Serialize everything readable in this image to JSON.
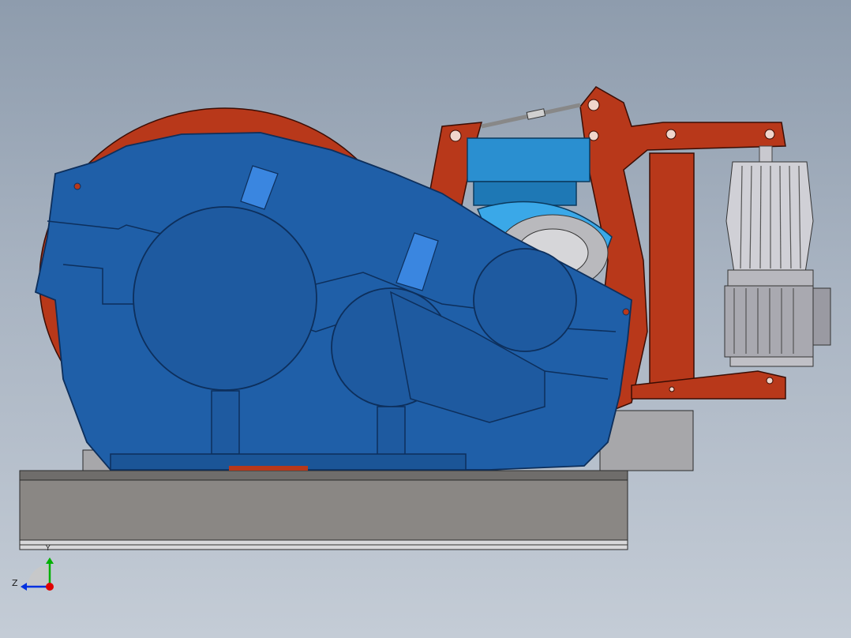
{
  "viewport": {
    "background_top": "#8e9cad",
    "background_bottom": "#c4ccd6"
  },
  "colors": {
    "gearbox_blue": "#1f5fa8",
    "gearbox_edge": "#0d2f5c",
    "gearbox_highlight": "#3a86e0",
    "drum_red": "#b8381a",
    "brake_red": "#b8381a",
    "motor_cyan": "#2a8fd0",
    "base_gray": "#8a8784",
    "steel_gray": "#b9b9bd",
    "thruster_gray": "#c9c9cf"
  },
  "triad": {
    "axis_z_label": "Z",
    "axis_y_label": "Y",
    "icon": "coordinate-triad-icon",
    "x_axis_color": "#e00000",
    "y_axis_color": "#00b000",
    "z_axis_color": "#0030e0"
  }
}
